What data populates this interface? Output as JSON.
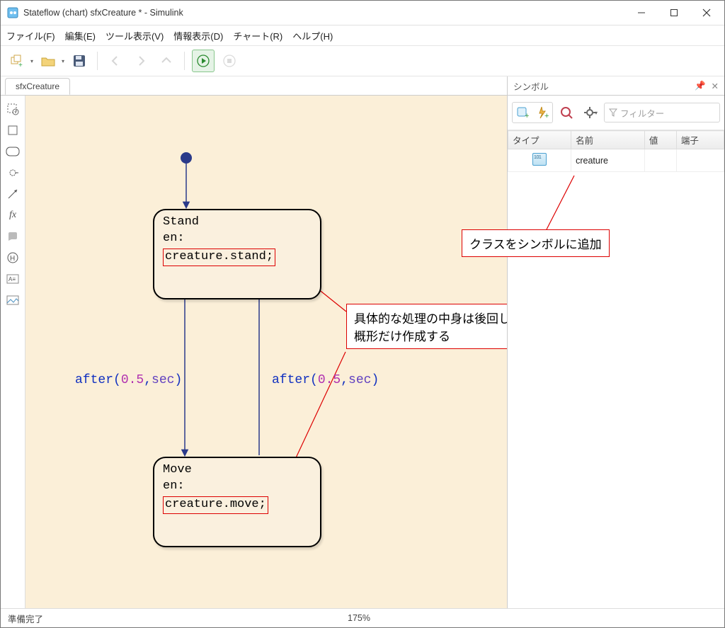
{
  "window": {
    "title": "Stateflow (chart) sfxCreature * - Simulink"
  },
  "menu": {
    "file": "ファイル(F)",
    "edit": "編集(E)",
    "tool": "ツール表示(V)",
    "info": "情報表示(D)",
    "chart": "チャート(R)",
    "help": "ヘルプ(H)"
  },
  "tab": {
    "label": "sfxCreature"
  },
  "chart": {
    "state1": {
      "name": "Stand",
      "entry": "en:",
      "code": "creature.stand;"
    },
    "state2": {
      "name": "Move",
      "entry": "en:",
      "code": "creature.move;"
    },
    "trans_left": {
      "fn": "after",
      "lp": "(",
      "num": "0.5",
      "comma": ",",
      "unit": "sec",
      "rp": ")"
    },
    "trans_right": {
      "fn": "after",
      "lp": "(",
      "num": "0.5",
      "comma": ",",
      "unit": "sec",
      "rp": ")"
    }
  },
  "annotations": {
    "detail1": "具体的な処理の中身は後回しにして",
    "detail2": "概形だけ作成する",
    "symbol": "クラスをシンボルに追加"
  },
  "symbols_panel": {
    "title": "シンボル",
    "filter_placeholder": "フィルター",
    "headers": {
      "type": "タイプ",
      "name": "名前",
      "value": "値",
      "port": "端子"
    },
    "rows": [
      {
        "name": "creature",
        "value": "",
        "port": ""
      }
    ]
  },
  "status": {
    "ready": "準備完了",
    "zoom": "175%"
  }
}
